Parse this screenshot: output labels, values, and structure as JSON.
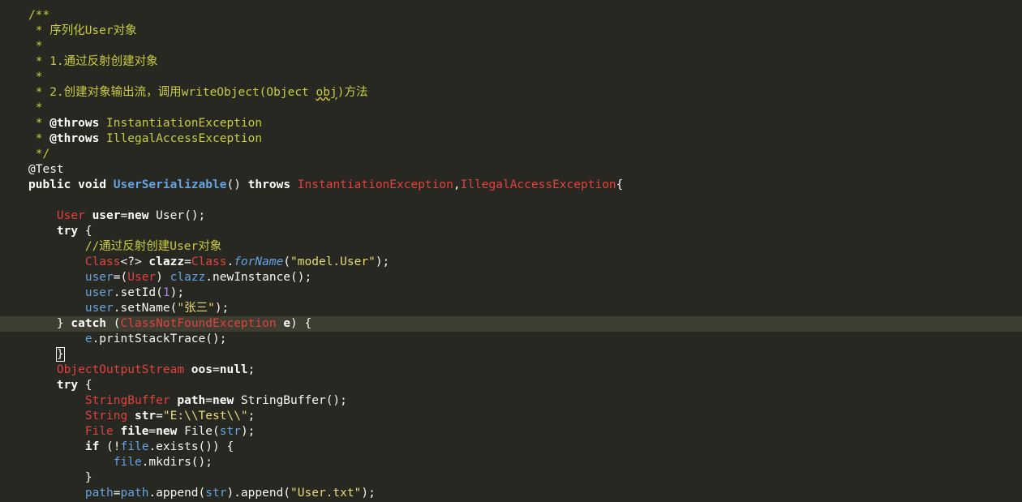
{
  "editor": {
    "lines": [
      {
        "tokens": [
          {
            "c": "c",
            "t": "/**"
          }
        ]
      },
      {
        "tokens": [
          {
            "c": "c",
            "t": " * 序列化User对象"
          }
        ]
      },
      {
        "tokens": [
          {
            "c": "c",
            "t": " *"
          }
        ]
      },
      {
        "tokens": [
          {
            "c": "c",
            "t": " * 1.通过反射创建对象"
          }
        ]
      },
      {
        "tokens": [
          {
            "c": "c",
            "t": " *"
          }
        ]
      },
      {
        "tokens": [
          {
            "c": "c",
            "t": " * 2.创建对象输出流，调用writeObject(Object "
          },
          {
            "c": "c sq",
            "t": "obj"
          },
          {
            "c": "c",
            "t": ")方法"
          }
        ]
      },
      {
        "tokens": [
          {
            "c": "c",
            "t": " *"
          }
        ]
      },
      {
        "tokens": [
          {
            "c": "c",
            "t": " * "
          },
          {
            "c": "k",
            "t": "@throws"
          },
          {
            "c": "c",
            "t": " InstantiationException"
          }
        ]
      },
      {
        "tokens": [
          {
            "c": "c",
            "t": " * "
          },
          {
            "c": "k",
            "t": "@throws"
          },
          {
            "c": "c",
            "t": " IllegalAccessException"
          }
        ]
      },
      {
        "tokens": [
          {
            "c": "c",
            "t": " */"
          }
        ]
      },
      {
        "tokens": [
          {
            "c": "an",
            "t": "@Test"
          }
        ]
      },
      {
        "tokens": [
          {
            "c": "k",
            "t": "public"
          },
          {
            "c": "p",
            "t": " "
          },
          {
            "c": "k",
            "t": "void"
          },
          {
            "c": "p",
            "t": " "
          },
          {
            "c": "fn",
            "t": "UserSerializable"
          },
          {
            "c": "p",
            "t": "() "
          },
          {
            "c": "k",
            "t": "throws"
          },
          {
            "c": "p",
            "t": " "
          },
          {
            "c": "ty",
            "t": "InstantiationException"
          },
          {
            "c": "p",
            "t": ","
          },
          {
            "c": "ty",
            "t": "IllegalAccessException"
          },
          {
            "c": "p",
            "t": "{"
          }
        ]
      },
      {
        "tokens": [
          {
            "c": "p",
            "t": ""
          }
        ]
      },
      {
        "tokens": [
          {
            "c": "p",
            "t": "    "
          },
          {
            "c": "ty",
            "t": "User"
          },
          {
            "c": "p",
            "t": " "
          },
          {
            "c": "vd",
            "t": "user"
          },
          {
            "c": "p",
            "t": "="
          },
          {
            "c": "k",
            "t": "new"
          },
          {
            "c": "p",
            "t": " User();"
          }
        ]
      },
      {
        "tokens": [
          {
            "c": "p",
            "t": "    "
          },
          {
            "c": "k",
            "t": "try"
          },
          {
            "c": "p",
            "t": " {"
          }
        ]
      },
      {
        "tokens": [
          {
            "c": "p",
            "t": "        "
          },
          {
            "c": "c",
            "t": "//通过反射创建User对象"
          }
        ]
      },
      {
        "tokens": [
          {
            "c": "p",
            "t": "        "
          },
          {
            "c": "ty",
            "t": "Class"
          },
          {
            "c": "p",
            "t": "<?> "
          },
          {
            "c": "vd",
            "t": "clazz"
          },
          {
            "c": "p",
            "t": "="
          },
          {
            "c": "ty",
            "t": "Class"
          },
          {
            "c": "p",
            "t": "."
          },
          {
            "c": "m",
            "t": "forName"
          },
          {
            "c": "p",
            "t": "("
          },
          {
            "c": "s",
            "t": "\"model.User\""
          },
          {
            "c": "p",
            "t": ");"
          }
        ]
      },
      {
        "tokens": [
          {
            "c": "p",
            "t": "        "
          },
          {
            "c": "v",
            "t": "user"
          },
          {
            "c": "p",
            "t": "=("
          },
          {
            "c": "ty",
            "t": "User"
          },
          {
            "c": "p",
            "t": ") "
          },
          {
            "c": "v",
            "t": "clazz"
          },
          {
            "c": "p",
            "t": ".newInstance();"
          }
        ]
      },
      {
        "tokens": [
          {
            "c": "p",
            "t": "        "
          },
          {
            "c": "v",
            "t": "user"
          },
          {
            "c": "p",
            "t": ".setId("
          },
          {
            "c": "n",
            "t": "1"
          },
          {
            "c": "p",
            "t": ");"
          }
        ]
      },
      {
        "tokens": [
          {
            "c": "p",
            "t": "        "
          },
          {
            "c": "v",
            "t": "user"
          },
          {
            "c": "p",
            "t": ".setName("
          },
          {
            "c": "s",
            "t": "\"张三\""
          },
          {
            "c": "p",
            "t": ");"
          }
        ]
      },
      {
        "current": true,
        "tokens": [
          {
            "c": "p",
            "t": "    } "
          },
          {
            "c": "k",
            "t": "catch"
          },
          {
            "c": "p",
            "t": " ("
          },
          {
            "c": "ty",
            "t": "ClassNotFoundException"
          },
          {
            "c": "p",
            "t": " "
          },
          {
            "c": "vd",
            "t": "e"
          },
          {
            "c": "p",
            "t": ") {"
          }
        ]
      },
      {
        "tokens": [
          {
            "c": "p",
            "t": "        "
          },
          {
            "c": "v",
            "t": "e"
          },
          {
            "c": "p",
            "t": ".printStackTrace();"
          }
        ]
      },
      {
        "tokens": [
          {
            "c": "p",
            "t": "    "
          },
          {
            "c": "p cur",
            "t": "}"
          }
        ]
      },
      {
        "tokens": [
          {
            "c": "p",
            "t": "    "
          },
          {
            "c": "ty",
            "t": "ObjectOutputStream"
          },
          {
            "c": "p",
            "t": " "
          },
          {
            "c": "vd",
            "t": "oos"
          },
          {
            "c": "p",
            "t": "="
          },
          {
            "c": "k",
            "t": "null"
          },
          {
            "c": "p",
            "t": ";"
          }
        ]
      },
      {
        "tokens": [
          {
            "c": "p",
            "t": "    "
          },
          {
            "c": "k",
            "t": "try"
          },
          {
            "c": "p",
            "t": " {"
          }
        ]
      },
      {
        "tokens": [
          {
            "c": "p",
            "t": "        "
          },
          {
            "c": "ty",
            "t": "StringBuffer"
          },
          {
            "c": "p",
            "t": " "
          },
          {
            "c": "vd",
            "t": "path"
          },
          {
            "c": "p",
            "t": "="
          },
          {
            "c": "k",
            "t": "new"
          },
          {
            "c": "p",
            "t": " StringBuffer();"
          }
        ]
      },
      {
        "tokens": [
          {
            "c": "p",
            "t": "        "
          },
          {
            "c": "ty",
            "t": "String"
          },
          {
            "c": "p",
            "t": " "
          },
          {
            "c": "vd",
            "t": "str"
          },
          {
            "c": "p",
            "t": "="
          },
          {
            "c": "s",
            "t": "\"E:\\\\Test\\\\\""
          },
          {
            "c": "p",
            "t": ";"
          }
        ]
      },
      {
        "tokens": [
          {
            "c": "p",
            "t": "        "
          },
          {
            "c": "ty",
            "t": "File"
          },
          {
            "c": "p",
            "t": " "
          },
          {
            "c": "vd",
            "t": "file"
          },
          {
            "c": "p",
            "t": "="
          },
          {
            "c": "k",
            "t": "new"
          },
          {
            "c": "p",
            "t": " File("
          },
          {
            "c": "v",
            "t": "str"
          },
          {
            "c": "p",
            "t": ");"
          }
        ]
      },
      {
        "tokens": [
          {
            "c": "p",
            "t": "        "
          },
          {
            "c": "k",
            "t": "if"
          },
          {
            "c": "p",
            "t": " (!"
          },
          {
            "c": "v",
            "t": "file"
          },
          {
            "c": "p",
            "t": ".exists()) {"
          }
        ]
      },
      {
        "tokens": [
          {
            "c": "p",
            "t": "            "
          },
          {
            "c": "v",
            "t": "file"
          },
          {
            "c": "p",
            "t": ".mkdirs();"
          }
        ]
      },
      {
        "tokens": [
          {
            "c": "p",
            "t": "        }"
          }
        ]
      },
      {
        "tokens": [
          {
            "c": "p",
            "t": "        "
          },
          {
            "c": "v",
            "t": "path"
          },
          {
            "c": "p",
            "t": "="
          },
          {
            "c": "v",
            "t": "path"
          },
          {
            "c": "p",
            "t": ".append("
          },
          {
            "c": "v",
            "t": "str"
          },
          {
            "c": "p",
            "t": ").append("
          },
          {
            "c": "s",
            "t": "\"User.txt\""
          },
          {
            "c": "p",
            "t": ");"
          }
        ]
      }
    ]
  }
}
